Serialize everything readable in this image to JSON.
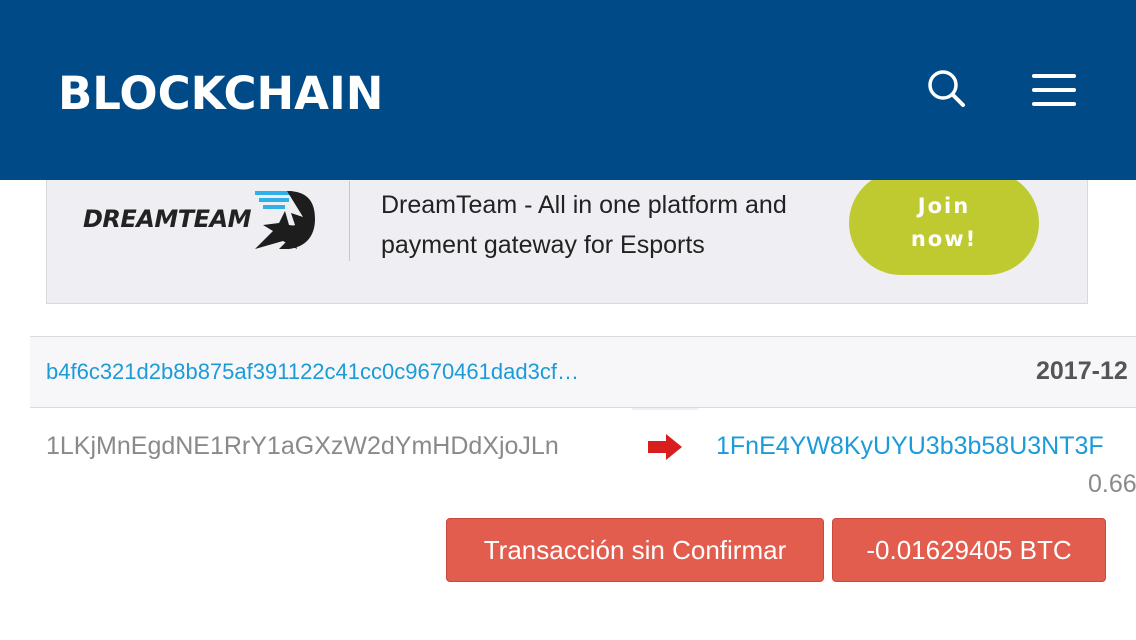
{
  "header": {
    "brand": "BLOCKCHAIN",
    "search_icon": "search-icon",
    "menu_icon": "hamburger-menu-icon",
    "background_color": "#004a87"
  },
  "ad": {
    "logo_text": "DREAMTEAM",
    "text": "DreamTeam - All in one platform and payment gateway for Esports",
    "join_label": "Join now!",
    "join_color": "#bfca31"
  },
  "transaction": {
    "hash": "b4f6c321d2b8b875af391122c41cc0c9670461dad3cf…",
    "date": "2017-12",
    "from_address": "1LKjMnEgdNE1RrY1aGXzW2dYmHDdXjoJLn",
    "arrow_icon": "red-arrow-right-icon",
    "to_address": "1FnE4YW8KyUYU3b3b58U3NT3F",
    "to_amount": "0.66",
    "status_label": "Transacción sin Confirmar",
    "amount_label": "-0.01629405 BTC",
    "button_color": "#e35d4f",
    "link_color": "#1b9bd8"
  }
}
